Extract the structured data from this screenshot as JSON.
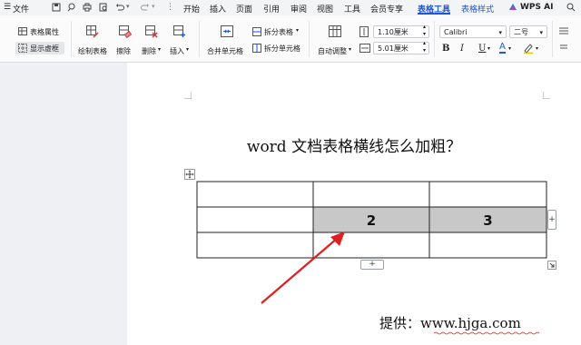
{
  "menubar": {
    "file": "文件",
    "tabs": [
      "开始",
      "插入",
      "页面",
      "引用",
      "审阅",
      "视图",
      "工具",
      "会员专享",
      "表格工具",
      "表格样式"
    ],
    "active_tab": "表格工具",
    "wps_ai": "WPS AI"
  },
  "ribbon": {
    "table_props": "表格属性",
    "show_gridlines": "显示虚框",
    "draw_table": "绘制表格",
    "eraser": "擦除",
    "delete": "删除",
    "insert": "插入",
    "merge_cells": "合并单元格",
    "split_table": "拆分表格",
    "split_cells": "拆分单元格",
    "autofit": "自动调整",
    "row_height": "1.10厘米",
    "col_width": "5.01厘米",
    "font": "Calibri",
    "font_size": "二号",
    "bold": "B",
    "italic": "I",
    "underline": "U",
    "font_color": "A"
  },
  "doc": {
    "title": "word 文档表格横线怎么加粗？",
    "cells": [
      "2",
      "3"
    ],
    "credit_label": "提供：",
    "credit_url": "www.hjga.com",
    "plus": "+"
  },
  "colors": {
    "accent": "#1d56d8",
    "selected_cell": "#c8c8c8",
    "arrow": "#e02020"
  }
}
